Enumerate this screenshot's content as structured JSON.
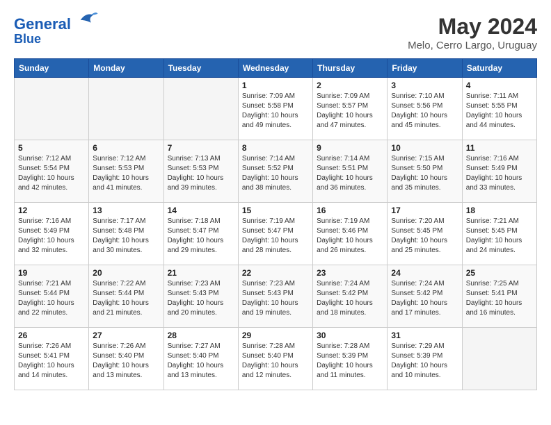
{
  "header": {
    "logo_line1": "General",
    "logo_line2": "Blue",
    "month_year": "May 2024",
    "location": "Melo, Cerro Largo, Uruguay"
  },
  "days_of_week": [
    "Sunday",
    "Monday",
    "Tuesday",
    "Wednesday",
    "Thursday",
    "Friday",
    "Saturday"
  ],
  "weeks": [
    [
      {
        "day": "",
        "info": ""
      },
      {
        "day": "",
        "info": ""
      },
      {
        "day": "",
        "info": ""
      },
      {
        "day": "1",
        "info": "Sunrise: 7:09 AM\nSunset: 5:58 PM\nDaylight: 10 hours\nand 49 minutes."
      },
      {
        "day": "2",
        "info": "Sunrise: 7:09 AM\nSunset: 5:57 PM\nDaylight: 10 hours\nand 47 minutes."
      },
      {
        "day": "3",
        "info": "Sunrise: 7:10 AM\nSunset: 5:56 PM\nDaylight: 10 hours\nand 45 minutes."
      },
      {
        "day": "4",
        "info": "Sunrise: 7:11 AM\nSunset: 5:55 PM\nDaylight: 10 hours\nand 44 minutes."
      }
    ],
    [
      {
        "day": "5",
        "info": "Sunrise: 7:12 AM\nSunset: 5:54 PM\nDaylight: 10 hours\nand 42 minutes."
      },
      {
        "day": "6",
        "info": "Sunrise: 7:12 AM\nSunset: 5:53 PM\nDaylight: 10 hours\nand 41 minutes."
      },
      {
        "day": "7",
        "info": "Sunrise: 7:13 AM\nSunset: 5:53 PM\nDaylight: 10 hours\nand 39 minutes."
      },
      {
        "day": "8",
        "info": "Sunrise: 7:14 AM\nSunset: 5:52 PM\nDaylight: 10 hours\nand 38 minutes."
      },
      {
        "day": "9",
        "info": "Sunrise: 7:14 AM\nSunset: 5:51 PM\nDaylight: 10 hours\nand 36 minutes."
      },
      {
        "day": "10",
        "info": "Sunrise: 7:15 AM\nSunset: 5:50 PM\nDaylight: 10 hours\nand 35 minutes."
      },
      {
        "day": "11",
        "info": "Sunrise: 7:16 AM\nSunset: 5:49 PM\nDaylight: 10 hours\nand 33 minutes."
      }
    ],
    [
      {
        "day": "12",
        "info": "Sunrise: 7:16 AM\nSunset: 5:49 PM\nDaylight: 10 hours\nand 32 minutes."
      },
      {
        "day": "13",
        "info": "Sunrise: 7:17 AM\nSunset: 5:48 PM\nDaylight: 10 hours\nand 30 minutes."
      },
      {
        "day": "14",
        "info": "Sunrise: 7:18 AM\nSunset: 5:47 PM\nDaylight: 10 hours\nand 29 minutes."
      },
      {
        "day": "15",
        "info": "Sunrise: 7:19 AM\nSunset: 5:47 PM\nDaylight: 10 hours\nand 28 minutes."
      },
      {
        "day": "16",
        "info": "Sunrise: 7:19 AM\nSunset: 5:46 PM\nDaylight: 10 hours\nand 26 minutes."
      },
      {
        "day": "17",
        "info": "Sunrise: 7:20 AM\nSunset: 5:45 PM\nDaylight: 10 hours\nand 25 minutes."
      },
      {
        "day": "18",
        "info": "Sunrise: 7:21 AM\nSunset: 5:45 PM\nDaylight: 10 hours\nand 24 minutes."
      }
    ],
    [
      {
        "day": "19",
        "info": "Sunrise: 7:21 AM\nSunset: 5:44 PM\nDaylight: 10 hours\nand 22 minutes."
      },
      {
        "day": "20",
        "info": "Sunrise: 7:22 AM\nSunset: 5:44 PM\nDaylight: 10 hours\nand 21 minutes."
      },
      {
        "day": "21",
        "info": "Sunrise: 7:23 AM\nSunset: 5:43 PM\nDaylight: 10 hours\nand 20 minutes."
      },
      {
        "day": "22",
        "info": "Sunrise: 7:23 AM\nSunset: 5:43 PM\nDaylight: 10 hours\nand 19 minutes."
      },
      {
        "day": "23",
        "info": "Sunrise: 7:24 AM\nSunset: 5:42 PM\nDaylight: 10 hours\nand 18 minutes."
      },
      {
        "day": "24",
        "info": "Sunrise: 7:24 AM\nSunset: 5:42 PM\nDaylight: 10 hours\nand 17 minutes."
      },
      {
        "day": "25",
        "info": "Sunrise: 7:25 AM\nSunset: 5:41 PM\nDaylight: 10 hours\nand 16 minutes."
      }
    ],
    [
      {
        "day": "26",
        "info": "Sunrise: 7:26 AM\nSunset: 5:41 PM\nDaylight: 10 hours\nand 14 minutes."
      },
      {
        "day": "27",
        "info": "Sunrise: 7:26 AM\nSunset: 5:40 PM\nDaylight: 10 hours\nand 13 minutes."
      },
      {
        "day": "28",
        "info": "Sunrise: 7:27 AM\nSunset: 5:40 PM\nDaylight: 10 hours\nand 13 minutes."
      },
      {
        "day": "29",
        "info": "Sunrise: 7:28 AM\nSunset: 5:40 PM\nDaylight: 10 hours\nand 12 minutes."
      },
      {
        "day": "30",
        "info": "Sunrise: 7:28 AM\nSunset: 5:39 PM\nDaylight: 10 hours\nand 11 minutes."
      },
      {
        "day": "31",
        "info": "Sunrise: 7:29 AM\nSunset: 5:39 PM\nDaylight: 10 hours\nand 10 minutes."
      },
      {
        "day": "",
        "info": ""
      }
    ]
  ]
}
